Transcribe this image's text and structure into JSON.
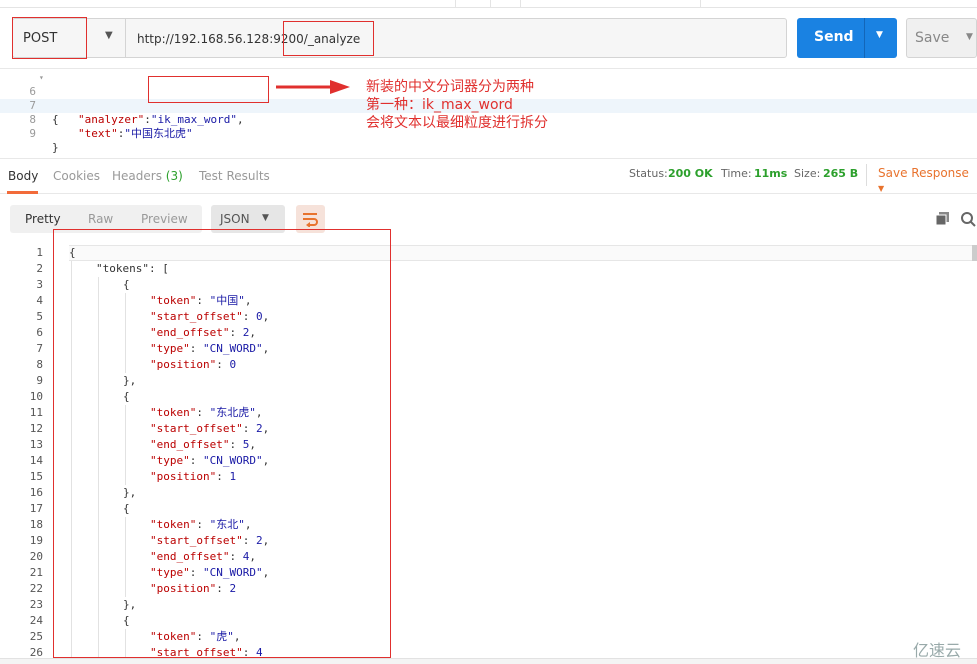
{
  "request": {
    "method": "POST",
    "url": "http://192.168.56.128:9200/_analyze",
    "send_label": "Send",
    "save_label": "Save"
  },
  "editor": {
    "lines": [
      {
        "num": "6",
        "fold": "▾",
        "text": "{"
      },
      {
        "num": "7",
        "key": "\"analyzer\"",
        "sep": ":",
        "value": "\"ik_max_word\"",
        "tail": ","
      },
      {
        "num": "8",
        "key": "\"text\"",
        "sep": ":",
        "value": "\"中国东北虎\"",
        "tail": ""
      },
      {
        "num": "9",
        "text": "}"
      }
    ]
  },
  "annotation": {
    "line1": "新装的中文分词器分为两种",
    "line2": "第一种：ik_max_word",
    "line3": "会将文本以最细粒度进行拆分",
    "color": "#e0302e"
  },
  "response_tabs": {
    "body": "Body",
    "cookies": "Cookies",
    "headers": "Headers",
    "headers_count": "(3)",
    "test_results": "Test Results"
  },
  "status": {
    "status_label": "Status:",
    "status_value": "200 OK",
    "time_label": "Time:",
    "time_value": "11ms",
    "size_label": "Size:",
    "size_value": "265 B",
    "save_response": "Save Response"
  },
  "view": {
    "pretty": "Pretty",
    "raw": "Raw",
    "preview": "Preview",
    "format": "JSON"
  },
  "response_lines": [
    {
      "n": "1",
      "ind": 0,
      "t": "{"
    },
    {
      "n": "2",
      "ind": 1,
      "t": "\"tokens\": ["
    },
    {
      "n": "3",
      "ind": 2,
      "t": "{"
    },
    {
      "n": "4",
      "ind": 3,
      "k": "\"token\"",
      "v": "\"中国\"",
      "c": ","
    },
    {
      "n": "5",
      "ind": 3,
      "k": "\"start_offset\"",
      "v": "0",
      "c": ","
    },
    {
      "n": "6",
      "ind": 3,
      "k": "\"end_offset\"",
      "v": "2",
      "c": ","
    },
    {
      "n": "7",
      "ind": 3,
      "k": "\"type\"",
      "v": "\"CN_WORD\"",
      "c": ","
    },
    {
      "n": "8",
      "ind": 3,
      "k": "\"position\"",
      "v": "0",
      "c": ""
    },
    {
      "n": "9",
      "ind": 2,
      "t": "},"
    },
    {
      "n": "10",
      "ind": 2,
      "t": "{"
    },
    {
      "n": "11",
      "ind": 3,
      "k": "\"token\"",
      "v": "\"东北虎\"",
      "c": ","
    },
    {
      "n": "12",
      "ind": 3,
      "k": "\"start_offset\"",
      "v": "2",
      "c": ","
    },
    {
      "n": "13",
      "ind": 3,
      "k": "\"end_offset\"",
      "v": "5",
      "c": ","
    },
    {
      "n": "14",
      "ind": 3,
      "k": "\"type\"",
      "v": "\"CN_WORD\"",
      "c": ","
    },
    {
      "n": "15",
      "ind": 3,
      "k": "\"position\"",
      "v": "1",
      "c": ""
    },
    {
      "n": "16",
      "ind": 2,
      "t": "},"
    },
    {
      "n": "17",
      "ind": 2,
      "t": "{"
    },
    {
      "n": "18",
      "ind": 3,
      "k": "\"token\"",
      "v": "\"东北\"",
      "c": ","
    },
    {
      "n": "19",
      "ind": 3,
      "k": "\"start_offset\"",
      "v": "2",
      "c": ","
    },
    {
      "n": "20",
      "ind": 3,
      "k": "\"end_offset\"",
      "v": "4",
      "c": ","
    },
    {
      "n": "21",
      "ind": 3,
      "k": "\"type\"",
      "v": "\"CN_WORD\"",
      "c": ","
    },
    {
      "n": "22",
      "ind": 3,
      "k": "\"position\"",
      "v": "2",
      "c": ""
    },
    {
      "n": "23",
      "ind": 2,
      "t": "},"
    },
    {
      "n": "24",
      "ind": 2,
      "t": "{"
    },
    {
      "n": "25",
      "ind": 3,
      "k": "\"token\"",
      "v": "\"虎\"",
      "c": ","
    },
    {
      "n": "26",
      "ind": 3,
      "k": "\"start_offset\"",
      "v": "4",
      "c": ""
    }
  ],
  "watermark": "亿速云",
  "icons": {
    "method_caret": "chevron-down-icon",
    "send_caret": "chevron-down-icon",
    "copy": "copy-icon",
    "search": "search-icon",
    "wrap": "wrap-lines-icon"
  }
}
